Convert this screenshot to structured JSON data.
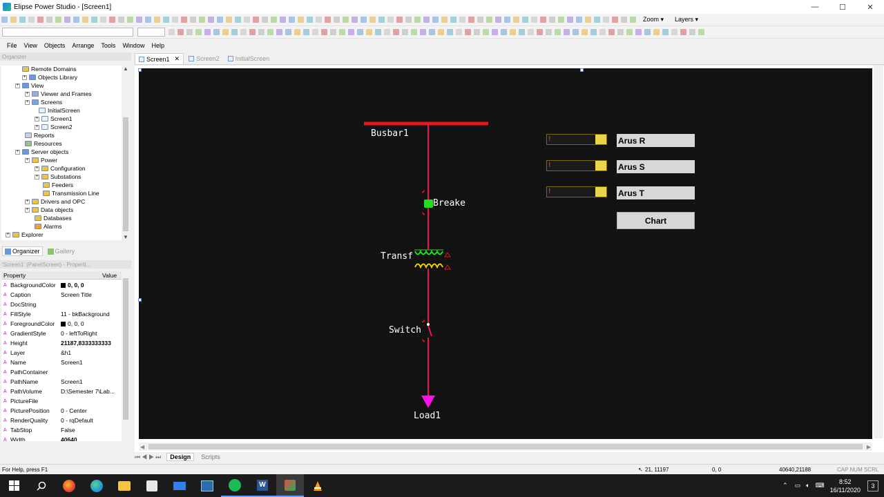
{
  "window": {
    "title": "Elipse Power Studio - [Screen1]",
    "minimize": "—",
    "maximize": "☐",
    "close": "✕"
  },
  "toolbar": {
    "zoom_label": "Zoom",
    "layers_label": "Layers"
  },
  "menu": [
    "File",
    "View",
    "Objects",
    "Arrange",
    "Tools",
    "Window",
    "Help"
  ],
  "organizer": {
    "header": "Organizer",
    "tree": [
      {
        "label": "Remote Domains",
        "icon": "folder"
      },
      {
        "label": "Objects Library",
        "icon": "library"
      },
      {
        "label": "View",
        "icon": "view"
      },
      {
        "label": "Viewer and Frames",
        "icon": "frames"
      },
      {
        "label": "Screens",
        "icon": "screens"
      },
      {
        "label": "InitialScreen",
        "icon": "screen"
      },
      {
        "label": "Screen1",
        "icon": "screen"
      },
      {
        "label": "Screen2",
        "icon": "screen"
      },
      {
        "label": "Reports",
        "icon": "reports"
      },
      {
        "label": "Resources",
        "icon": "resources"
      },
      {
        "label": "Server objects",
        "icon": "server"
      },
      {
        "label": "Power",
        "icon": "power"
      },
      {
        "label": "Configuration",
        "icon": "folder"
      },
      {
        "label": "Substations",
        "icon": "folder"
      },
      {
        "label": "Feeders",
        "icon": "folder"
      },
      {
        "label": "Transmission Line",
        "icon": "folder"
      },
      {
        "label": "Drivers and OPC",
        "icon": "folder"
      },
      {
        "label": "Data objects",
        "icon": "folder"
      },
      {
        "label": "Databases",
        "icon": "database"
      },
      {
        "label": "Alarms",
        "icon": "alarm"
      },
      {
        "label": "Explorer",
        "icon": "folder"
      }
    ]
  },
  "panel_tabs": [
    "Organizer",
    "Gallery"
  ],
  "properties": {
    "header": "'Screen1' (PanelScreen) - Properti...",
    "col_property": "Property",
    "col_value": "Value",
    "rows": [
      {
        "name": "BackgroundColor",
        "value": "0, 0, 0",
        "swatch": "#000000"
      },
      {
        "name": "Caption",
        "value": "Screen Title"
      },
      {
        "name": "DocString",
        "value": ""
      },
      {
        "name": "FillStyle",
        "value": "11 - bkBackground"
      },
      {
        "name": "ForegroundColor",
        "value": "0, 0, 0",
        "swatch": "#000000"
      },
      {
        "name": "GradientStyle",
        "value": "0 - leftToRight"
      },
      {
        "name": "Height",
        "value": "21187,8333333333"
      },
      {
        "name": "Layer",
        "value": "&h1"
      },
      {
        "name": "Name",
        "value": "Screen1"
      },
      {
        "name": "PathContainer",
        "value": ""
      },
      {
        "name": "PathName",
        "value": "Screen1"
      },
      {
        "name": "PathVolume",
        "value": "D:\\Semester 7\\Lab..."
      },
      {
        "name": "PictureFile",
        "value": ""
      },
      {
        "name": "PicturePosition",
        "value": "0 - Center"
      },
      {
        "name": "RenderQuality",
        "value": "0 - rqDefault"
      },
      {
        "name": "TabStop",
        "value": "False"
      },
      {
        "name": "Width",
        "value": "40640"
      }
    ]
  },
  "doc_tabs": [
    {
      "label": "Screen1",
      "active": true
    },
    {
      "label": "Screen2",
      "active": false
    },
    {
      "label": "InitialScreen",
      "active": false
    }
  ],
  "diagram": {
    "busbar_label": "Busbar1",
    "breaker_label": "Breake",
    "transformer_label": "Transf",
    "switch_label": "Switch",
    "load_label": "Load1",
    "busbar_color": "#e41818",
    "line_color": "#e8155a",
    "load_color": "#ff10e8",
    "breaker_color": "#22dd22",
    "transformer_primary_color": "#22dd22",
    "transformer_secondary_color": "#f0d000",
    "arus_labels": [
      "Arus R",
      "Arus S",
      "Arus T"
    ],
    "chart_button": "Chart"
  },
  "bottom_tabs": [
    {
      "label": "Design",
      "active": true
    },
    {
      "label": "Scripts",
      "active": false
    }
  ],
  "status": {
    "help": "For Help, press F1",
    "cursor": "21, 11197",
    "offset": "0, 0",
    "size": "40640,21188",
    "keys": "CAP NUM SCRL"
  },
  "taskbar": {
    "time": "8:52",
    "date": "16/11/2020",
    "notifications": "3"
  }
}
